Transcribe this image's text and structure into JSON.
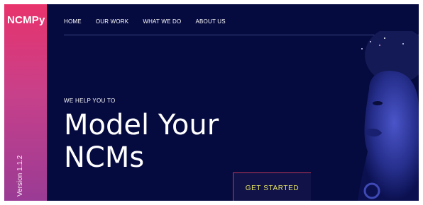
{
  "brand": {
    "name": "NCMPy"
  },
  "sidebar": {
    "version": "Version 1.1.2"
  },
  "nav": {
    "items": [
      {
        "label": "HOME"
      },
      {
        "label": "OUR WORK"
      },
      {
        "label": "WHAT WE DO"
      },
      {
        "label": "ABOUT US"
      }
    ]
  },
  "hero": {
    "kicker": "WE HELP YOU TO",
    "headline_line1": "Model Your",
    "headline_line2": "NCMs",
    "cta_label": "GET STARTED"
  },
  "colors": {
    "background": "#050a3f",
    "sidebar_top": "#e8336c",
    "sidebar_bottom": "#9a3b95",
    "cta_text": "#e7e466",
    "cta_border": "#c0395c"
  }
}
